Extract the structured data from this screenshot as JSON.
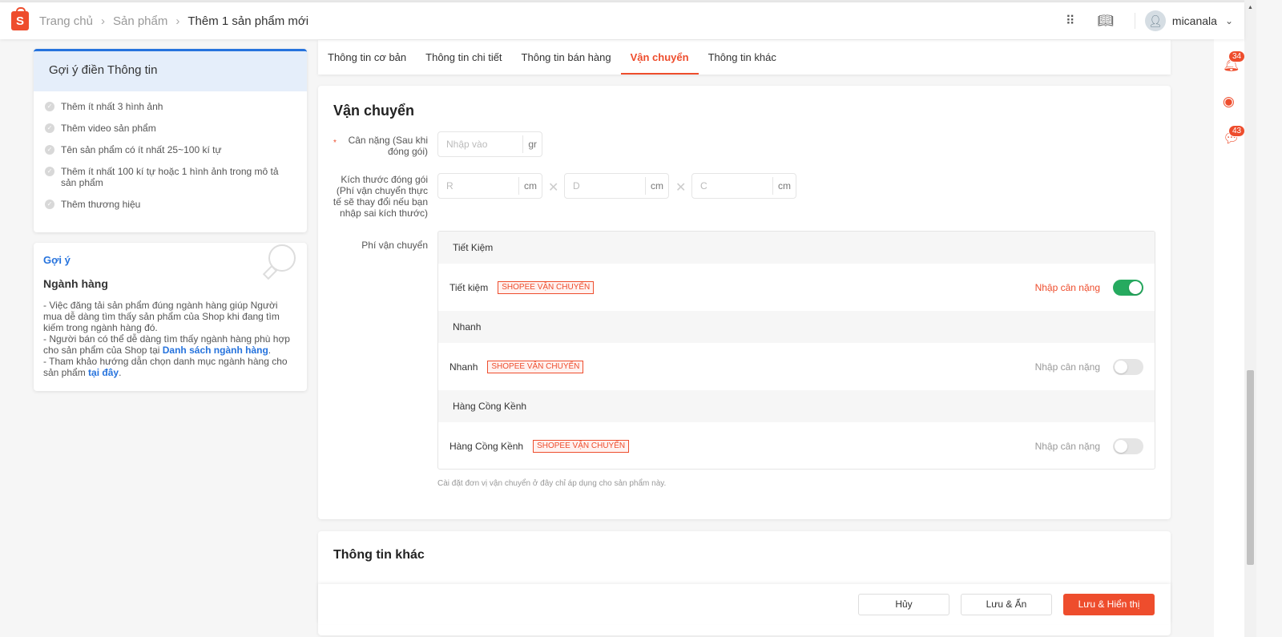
{
  "header": {
    "logo": "S",
    "breadcrumb": [
      "Trang chủ",
      "Sản phẩm",
      "Thêm 1 sản phẩm mới"
    ],
    "username": "micanala"
  },
  "hint_panel": {
    "title": "Gợi ý điền Thông tin",
    "items": [
      "Thêm ít nhất 3 hình ảnh",
      "Thêm video sản phẩm",
      "Tên sản phẩm có ít nhất 25~100 kí tự",
      "Thêm ít nhất 100 kí tự hoặc 1 hình ảnh trong mô tả sản phẩm",
      "Thêm thương hiệu"
    ]
  },
  "suggest_panel": {
    "label": "Gợi ý",
    "title": "Ngành hàng",
    "p1": "- Việc đăng tải sản phẩm đúng ngành hàng giúp Người mua dễ dàng tìm thấy sản phẩm của Shop khi đang tìm kiếm trong ngành hàng đó.",
    "p2": "- Người bán có thể dễ dàng tìm thấy ngành hàng phù hợp cho sản phẩm của Shop tại ",
    "link1": "Danh sách ngành hàng",
    "p2end": ".",
    "p3": "- Tham khảo hướng dẫn chọn danh mục ngành hàng cho sản phẩm ",
    "link2": "tại đây",
    "p3end": "."
  },
  "tabs": [
    "Thông tin cơ bản",
    "Thông tin chi tiết",
    "Thông tin bán hàng",
    "Vận chuyển",
    "Thông tin khác"
  ],
  "shipping": {
    "title": "Vận chuyển",
    "weight_label": "Cân nặng (Sau khi đóng gói)",
    "weight_placeholder": "Nhập vào",
    "weight_unit": "gr",
    "size_label": "Kích thước đóng gói (Phí vận chuyển thực tế sẽ thay đổi nếu bạn nhập sai kích thước)",
    "dims": [
      {
        "ph": "R",
        "unit": "cm"
      },
      {
        "ph": "D",
        "unit": "cm"
      },
      {
        "ph": "C",
        "unit": "cm"
      }
    ],
    "fee_label": "Phí vận chuyển",
    "groups": [
      {
        "header": "Tiết Kiệm",
        "name": "Tiết kiệm",
        "badge": "SHOPEE VẬN CHUYỂN",
        "action": "Nhập cân nặng",
        "enabled": true
      },
      {
        "header": "Nhanh",
        "name": "Nhanh",
        "badge": "SHOPEE VẬN CHUYỂN",
        "action": "Nhập cân nặng",
        "enabled": false
      },
      {
        "header": "Hàng Cồng Kềnh",
        "name": "Hàng Cồng Kềnh",
        "badge": "SHOPEE VẬN CHUYỂN",
        "action": "Nhập cân nặng",
        "enabled": false
      }
    ],
    "note": "Cài đặt đơn vị vận chuyển ở đây chỉ áp dụng cho sản phẩm này."
  },
  "other": {
    "title": "Thông tin khác"
  },
  "footer": {
    "cancel": "Hủy",
    "save_hide": "Lưu & Ẩn",
    "save_show": "Lưu & Hiển thị"
  },
  "right_sidebar": {
    "notifications": "34",
    "messages": "43"
  }
}
